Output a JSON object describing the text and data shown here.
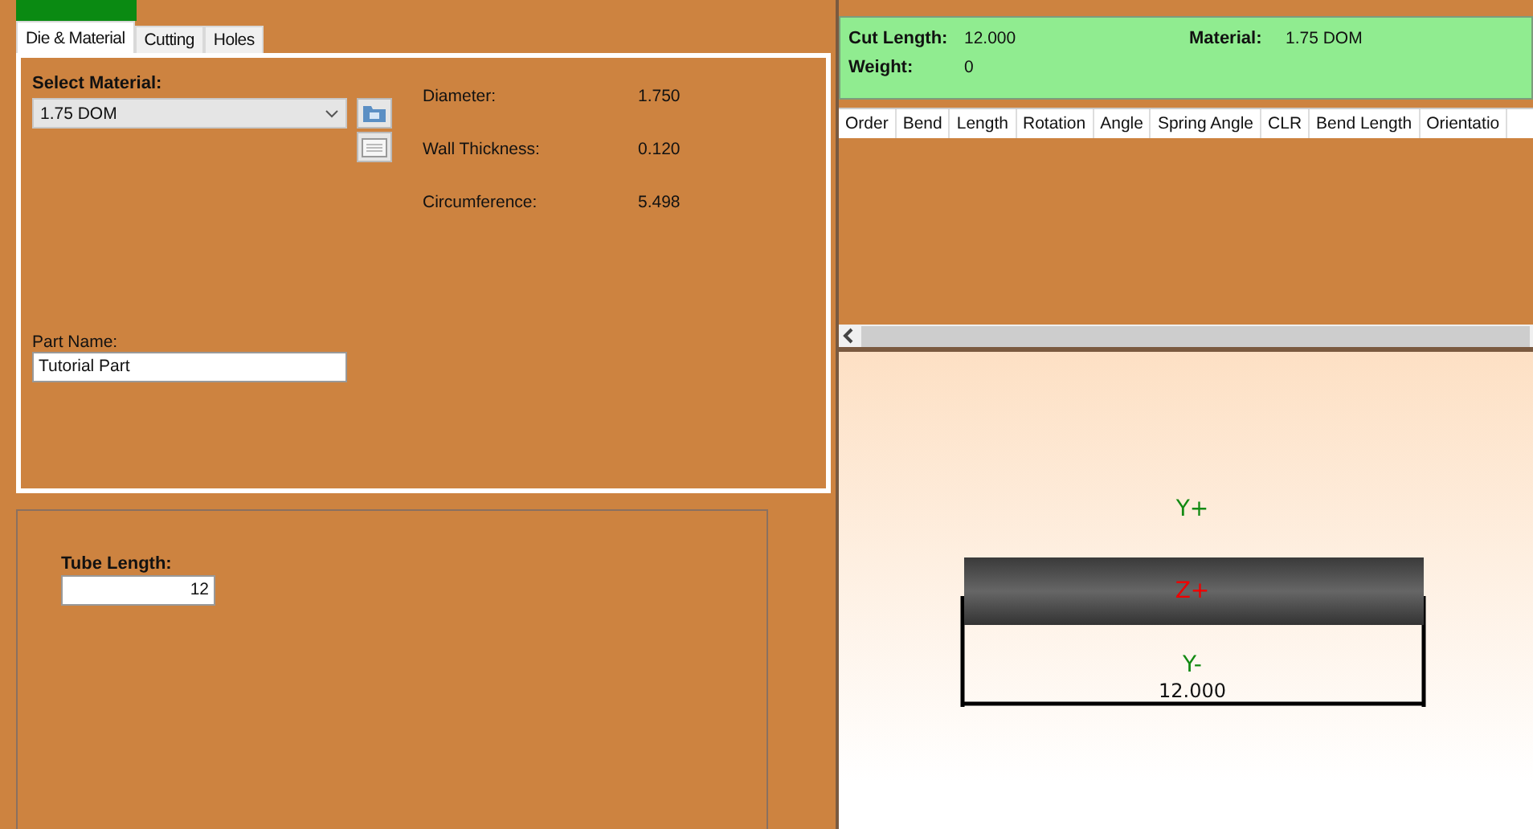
{
  "tabs": [
    {
      "label": "Die & Material",
      "selected": true
    },
    {
      "label": "Cutting",
      "selected": false
    },
    {
      "label": "Holes",
      "selected": false
    }
  ],
  "material": {
    "label": "Select Material:",
    "value": "1.75 DOM"
  },
  "properties": [
    {
      "label": "Diameter:",
      "value": "1.750"
    },
    {
      "label": "Wall Thickness:",
      "value": "0.120"
    },
    {
      "label": "Circumference:",
      "value": "5.498"
    }
  ],
  "part_name": {
    "label": "Part Name:",
    "value": "Tutorial Part"
  },
  "tube_length": {
    "label": "Tube Length:",
    "value": "12"
  },
  "summary": [
    [
      {
        "label": "Cut Length:",
        "value": "12.000"
      },
      {
        "label": "Material:",
        "value": "1.75 DOM"
      }
    ],
    [
      {
        "label": "Weight:",
        "value": "0"
      }
    ]
  ],
  "table": {
    "columns": [
      "Order",
      "Bend",
      "Length",
      "Rotation",
      "Angle",
      "Spring Angle",
      "CLR",
      "Bend Length",
      "Orientatio"
    ]
  },
  "view": {
    "top_axis": "Y+",
    "center_axis": "Z+",
    "bottom_axis": "Y-",
    "dimension": "12.000"
  }
}
